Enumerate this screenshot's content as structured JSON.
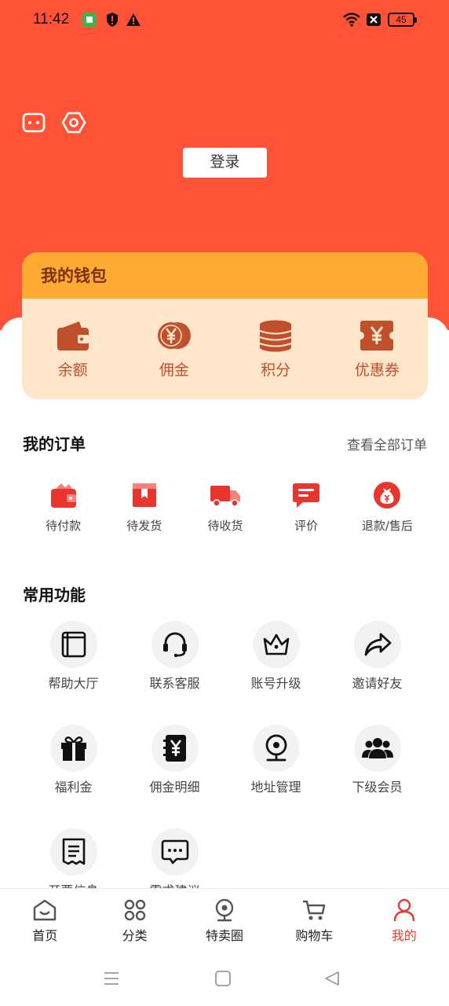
{
  "status_bar": {
    "time": "11:42",
    "battery": "45",
    "icons": [
      "app-notification-icon",
      "shield-icon",
      "warning-icon",
      "wifi-icon",
      "sim-icon",
      "battery-icon"
    ]
  },
  "header": {
    "icons": [
      "message-icon",
      "settings-icon"
    ],
    "login_label": "登录"
  },
  "wallet": {
    "title": "我的钱包",
    "items": [
      {
        "label": "余额",
        "icon": "wallet-icon"
      },
      {
        "label": "佣金",
        "icon": "coin-yen-icon"
      },
      {
        "label": "积分",
        "icon": "coin-stack-icon"
      },
      {
        "label": "优惠券",
        "icon": "coupon-icon"
      }
    ]
  },
  "orders": {
    "title": "我的订单",
    "view_all": "查看全部订单",
    "items": [
      {
        "label": "待付款",
        "icon": "pending-payment-icon"
      },
      {
        "label": "待发货",
        "icon": "pending-shipment-icon"
      },
      {
        "label": "待收货",
        "icon": "delivery-truck-icon"
      },
      {
        "label": "评价",
        "icon": "review-icon"
      },
      {
        "label": "退款/售后",
        "icon": "refund-bag-icon"
      }
    ]
  },
  "functions": {
    "title": "常用功能",
    "items": [
      {
        "label": "帮助大厅",
        "icon": "book-icon"
      },
      {
        "label": "联系客服",
        "icon": "headset-icon"
      },
      {
        "label": "账号升级",
        "icon": "crown-icon"
      },
      {
        "label": "邀请好友",
        "icon": "share-icon"
      },
      {
        "label": "福利金",
        "icon": "gift-icon"
      },
      {
        "label": "佣金明细",
        "icon": "yen-notebook-icon"
      },
      {
        "label": "地址管理",
        "icon": "location-pin-icon"
      },
      {
        "label": "下级会员",
        "icon": "members-icon"
      },
      {
        "label": "开票信息",
        "icon": "invoice-icon"
      },
      {
        "label": "需求建议",
        "icon": "chat-icon"
      }
    ]
  },
  "tabbar": {
    "items": [
      {
        "label": "首页",
        "icon": "home-icon"
      },
      {
        "label": "分类",
        "icon": "category-icon"
      },
      {
        "label": "特卖圈",
        "icon": "special-sale-icon"
      },
      {
        "label": "购物车",
        "icon": "cart-icon"
      },
      {
        "label": "我的",
        "icon": "profile-icon",
        "active": true
      }
    ],
    "active_color": "#E53B2C"
  },
  "colors": {
    "hero": "#FF5338",
    "wallet_header": "#FFAA33",
    "wallet_body": "#FFE6CB",
    "wallet_icon": "#C0502B"
  }
}
